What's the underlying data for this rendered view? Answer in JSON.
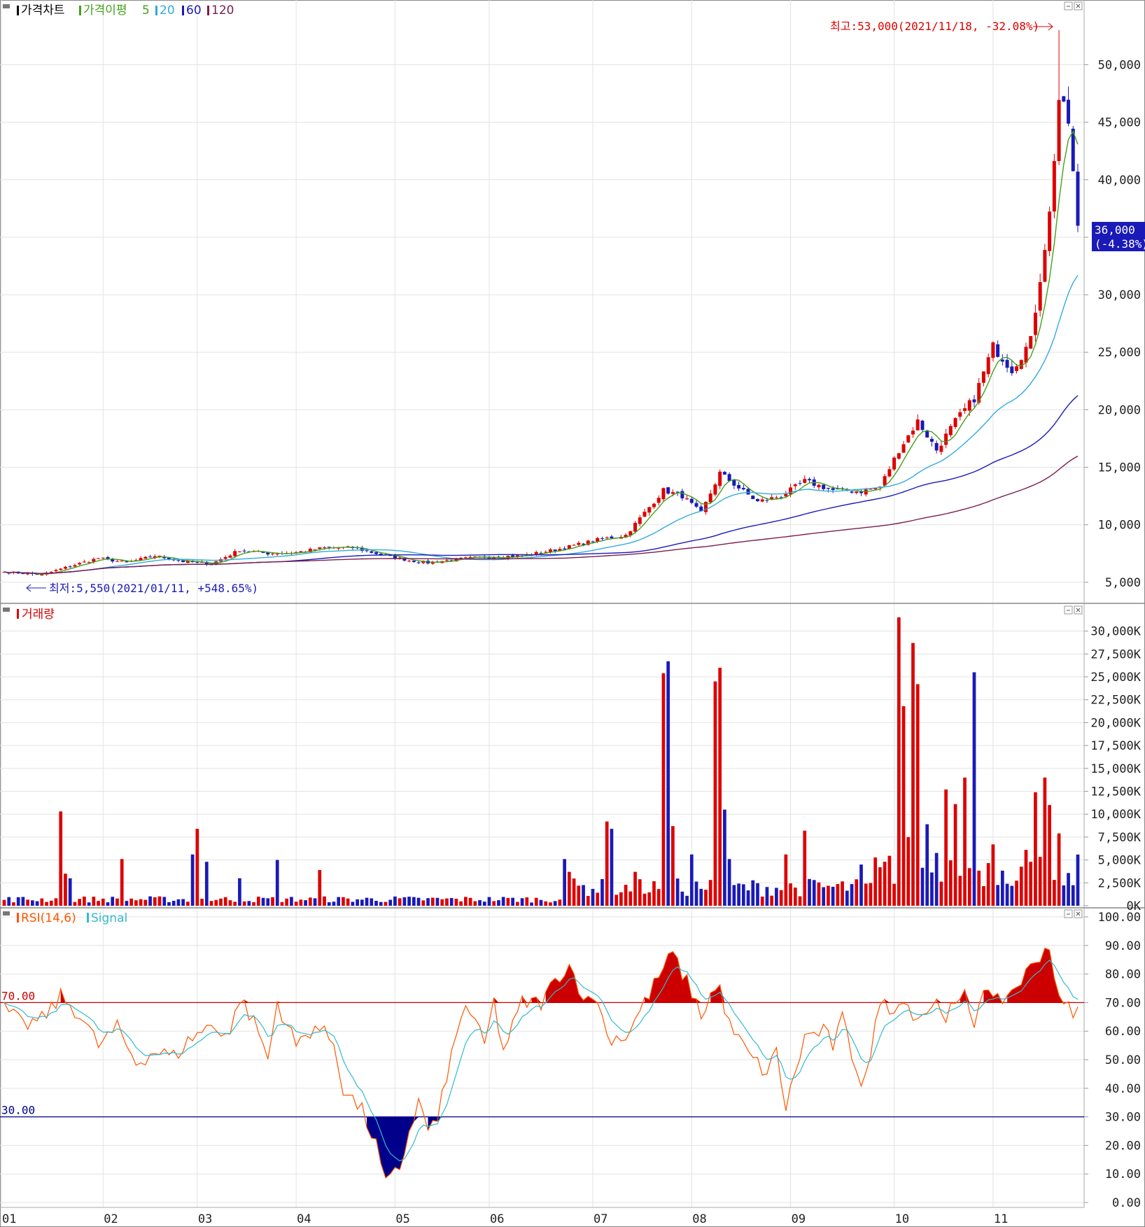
{
  "legends": {
    "price_label": "가격차트",
    "ma_label": "가격이평",
    "ma5": "5",
    "ma20": "20",
    "ma60": "60",
    "ma120": "120",
    "volume_label": "거래량",
    "rsi_label": "RSI(14,6)",
    "signal_label": "Signal"
  },
  "annotations": {
    "high": "최고:53,000(2021/11/18, -32.08%)",
    "low": "최저:5,550(2021/01/11, +548.65%)",
    "last_price": "36,000",
    "last_change": "(-4.38%)"
  },
  "colors": {
    "up": "#dd0000",
    "down": "#1a1ab8",
    "ma5": "#44a01c",
    "ma20": "#33aadd",
    "ma60": "#1a1ab8",
    "ma120": "#7a1e4e",
    "rsi": "#ff5500",
    "signal": "#33bbcc",
    "over": "#cc0000",
    "under": "#00008b",
    "grid": "#e3e3e3",
    "axis": "#aaaaaa"
  },
  "chart_data": [
    {
      "type": "candlestick",
      "x_ticks": [
        "01",
        "02",
        "03",
        "04",
        "05",
        "06",
        "07",
        "08",
        "09",
        "10",
        "11"
      ],
      "y_ticks": [
        5000,
        10000,
        15000,
        20000,
        25000,
        30000,
        35000,
        40000,
        45000,
        50000
      ],
      "y_tick_labels": [
        "5,000",
        "10,000",
        "15,000",
        "20,000",
        "25,000",
        "30,000",
        "35,000",
        "40,000",
        "45,000",
        "50,000"
      ],
      "ylim": [
        4200,
        53800
      ],
      "bars": 229,
      "high": 53000,
      "low": 5550,
      "last": 36000,
      "anchors": [
        [
          0,
          5900
        ],
        [
          8,
          5650
        ],
        [
          14,
          6400
        ],
        [
          20,
          7100
        ],
        [
          26,
          6700
        ],
        [
          32,
          7300
        ],
        [
          38,
          6800
        ],
        [
          44,
          6600
        ],
        [
          50,
          7800
        ],
        [
          56,
          7500
        ],
        [
          62,
          7600
        ],
        [
          68,
          8000
        ],
        [
          74,
          8000
        ],
        [
          80,
          7400
        ],
        [
          86,
          6900
        ],
        [
          90,
          6700
        ],
        [
          96,
          7000
        ],
        [
          102,
          7200
        ],
        [
          110,
          7300
        ],
        [
          118,
          7900
        ],
        [
          126,
          8700
        ],
        [
          132,
          9100
        ],
        [
          140,
          13000
        ],
        [
          144,
          12500
        ],
        [
          148,
          11000
        ],
        [
          152,
          14500
        ],
        [
          156,
          13200
        ],
        [
          160,
          12000
        ],
        [
          165,
          12500
        ],
        [
          170,
          13800
        ],
        [
          176,
          13000
        ],
        [
          182,
          12900
        ],
        [
          186,
          13300
        ],
        [
          190,
          16500
        ],
        [
          194,
          19000
        ],
        [
          198,
          16500
        ],
        [
          202,
          19000
        ],
        [
          206,
          21000
        ],
        [
          210,
          25500
        ],
        [
          214,
          23500
        ],
        [
          218,
          26000
        ],
        [
          222,
          37000
        ],
        [
          224,
          47000
        ],
        [
          226,
          45000
        ],
        [
          228,
          36000
        ]
      ],
      "ma_windows": [
        5,
        20,
        60,
        120
      ]
    },
    {
      "type": "bar",
      "name": "거래량",
      "y_ticks": [
        0,
        2500,
        5000,
        7500,
        10000,
        12500,
        15000,
        17500,
        20000,
        22500,
        25000,
        27500,
        30000
      ],
      "y_tick_labels": [
        "0K",
        "2,500K",
        "5,000K",
        "7,500K",
        "10,000K",
        "12,500K",
        "15,000K",
        "17,500K",
        "20,000K",
        "22,500K",
        "25,000K",
        "27,500K",
        "30,000K"
      ],
      "ylim": [
        0,
        31500
      ],
      "spikes": [
        [
          12,
          10300
        ],
        [
          13,
          3500
        ],
        [
          14,
          3000
        ],
        [
          25,
          5100
        ],
        [
          40,
          5600
        ],
        [
          41,
          8400
        ],
        [
          43,
          4800
        ],
        [
          50,
          3000
        ],
        [
          58,
          5000
        ],
        [
          67,
          3900
        ],
        [
          119,
          5100
        ],
        [
          120,
          3700
        ],
        [
          128,
          9200
        ],
        [
          129,
          8400
        ],
        [
          134,
          3700
        ],
        [
          140,
          25400
        ],
        [
          141,
          26700
        ],
        [
          142,
          8700
        ],
        [
          146,
          5600
        ],
        [
          151,
          24500
        ],
        [
          152,
          26000
        ],
        [
          153,
          10500
        ],
        [
          154,
          5100
        ],
        [
          166,
          5600
        ],
        [
          170,
          8200
        ],
        [
          182,
          4500
        ],
        [
          186,
          4200
        ],
        [
          190,
          31500
        ],
        [
          191,
          21800
        ],
        [
          192,
          7500
        ],
        [
          193,
          28700
        ],
        [
          194,
          24200
        ],
        [
          196,
          8900
        ],
        [
          200,
          12700
        ],
        [
          202,
          11100
        ],
        [
          204,
          14000
        ],
        [
          206,
          25500
        ],
        [
          210,
          6700
        ],
        [
          217,
          6100
        ],
        [
          219,
          12400
        ],
        [
          221,
          14000
        ],
        [
          222,
          11000
        ],
        [
          224,
          7900
        ]
      ]
    },
    {
      "type": "area",
      "name": "RSI(14,6)",
      "y_ticks": [
        0,
        10,
        20,
        30,
        40,
        50,
        60,
        70,
        80,
        90,
        100
      ],
      "y_tick_labels": [
        "0.00",
        "10.00",
        "20.00",
        "30.00",
        "40.00",
        "50.00",
        "60.00",
        "70.00",
        "80.00",
        "90.00",
        "100.00"
      ],
      "ylim": [
        0,
        100
      ],
      "levels": [
        70,
        30
      ],
      "level_labels": [
        "70.00",
        "30.00"
      ],
      "anchors": [
        [
          0,
          68
        ],
        [
          4,
          62
        ],
        [
          8,
          64
        ],
        [
          12,
          72
        ],
        [
          16,
          66
        ],
        [
          20,
          55
        ],
        [
          24,
          61
        ],
        [
          28,
          49
        ],
        [
          32,
          53
        ],
        [
          36,
          51
        ],
        [
          40,
          58
        ],
        [
          44,
          62
        ],
        [
          48,
          59
        ],
        [
          50,
          72
        ],
        [
          54,
          60
        ],
        [
          56,
          50
        ],
        [
          58,
          70
        ],
        [
          62,
          55
        ],
        [
          66,
          62
        ],
        [
          70,
          56
        ],
        [
          72,
          40
        ],
        [
          76,
          32
        ],
        [
          79,
          20
        ],
        [
          81,
          6
        ],
        [
          84,
          12
        ],
        [
          86,
          25
        ],
        [
          88,
          35
        ],
        [
          90,
          26
        ],
        [
          92,
          28
        ],
        [
          94,
          45
        ],
        [
          98,
          70
        ],
        [
          102,
          55
        ],
        [
          104,
          70
        ],
        [
          106,
          53
        ],
        [
          110,
          70
        ],
        [
          114,
          70
        ],
        [
          118,
          80
        ],
        [
          120,
          83
        ],
        [
          122,
          76
        ],
        [
          124,
          70
        ],
        [
          126,
          72
        ],
        [
          128,
          58
        ],
        [
          132,
          58
        ],
        [
          136,
          70
        ],
        [
          140,
          82
        ],
        [
          142,
          87
        ],
        [
          144,
          80
        ],
        [
          146,
          74
        ],
        [
          148,
          65
        ],
        [
          150,
          73
        ],
        [
          152,
          75
        ],
        [
          154,
          62
        ],
        [
          158,
          52
        ],
        [
          162,
          45
        ],
        [
          164,
          53
        ],
        [
          166,
          33
        ],
        [
          170,
          58
        ],
        [
          174,
          60
        ],
        [
          176,
          55
        ],
        [
          178,
          64
        ],
        [
          180,
          52
        ],
        [
          182,
          43
        ],
        [
          184,
          50
        ],
        [
          186,
          72
        ],
        [
          188,
          66
        ],
        [
          190,
          72
        ],
        [
          194,
          65
        ],
        [
          198,
          70
        ],
        [
          200,
          66
        ],
        [
          202,
          68
        ],
        [
          204,
          72
        ],
        [
          206,
          63
        ],
        [
          208,
          77
        ],
        [
          210,
          69
        ],
        [
          214,
          74
        ],
        [
          218,
          82
        ],
        [
          220,
          87
        ],
        [
          222,
          90
        ],
        [
          224,
          70
        ],
        [
          226,
          68
        ],
        [
          228,
          67
        ]
      ]
    }
  ]
}
